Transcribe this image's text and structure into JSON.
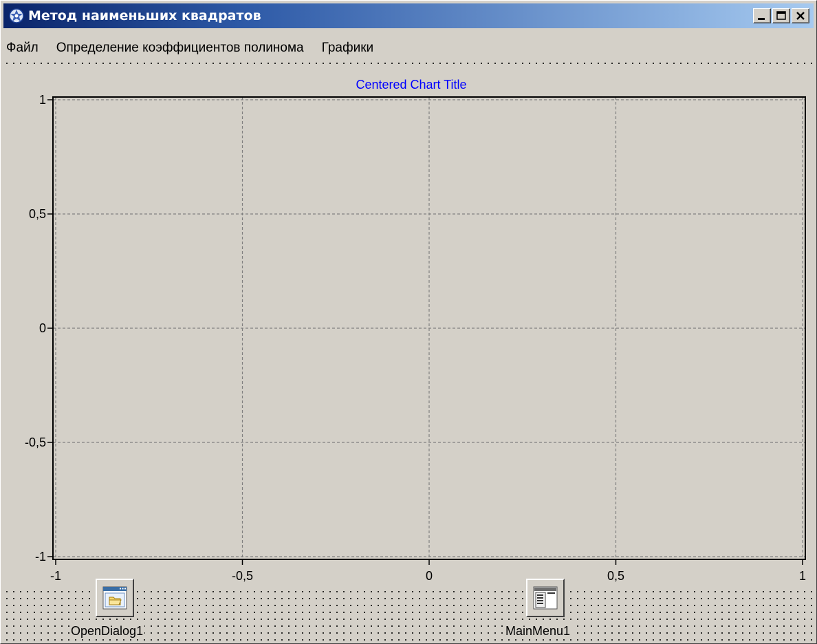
{
  "window": {
    "title": "Метод наименьших квадратов",
    "icon": "app-icon",
    "buttons": [
      "minimize-icon",
      "maximize-icon",
      "close-icon"
    ]
  },
  "menu": {
    "items": [
      {
        "label": "Файл"
      },
      {
        "label": "Определение коэффициентов полинома"
      },
      {
        "label": "Графики"
      }
    ]
  },
  "chart_data": {
    "type": "line",
    "title": "Centered Chart Title",
    "xlabel": "",
    "ylabel": "",
    "xlim": [
      -1,
      1
    ],
    "ylim": [
      -1,
      1
    ],
    "x_ticks": [
      -1,
      -0.5,
      0,
      0.5,
      1
    ],
    "y_ticks": [
      1,
      0.5,
      0,
      -0.5,
      -1
    ],
    "x_tick_labels": [
      "-1",
      "-0,5",
      "0",
      "0,5",
      "1"
    ],
    "y_tick_labels": [
      "1",
      "0,5",
      "0",
      "-0,5",
      "-1"
    ],
    "grid": true,
    "series": [],
    "colors": {
      "title": "#0000ff",
      "axis": "#000000",
      "grid": "#808080"
    }
  },
  "components": [
    {
      "label": "OpenDialog1",
      "icon": "open-dialog-icon"
    },
    {
      "label": "MainMenu1",
      "icon": "main-menu-icon"
    }
  ],
  "colors": {
    "face": "#d4d0c8",
    "title_start": "#0a246a",
    "title_end": "#a6caf0"
  }
}
